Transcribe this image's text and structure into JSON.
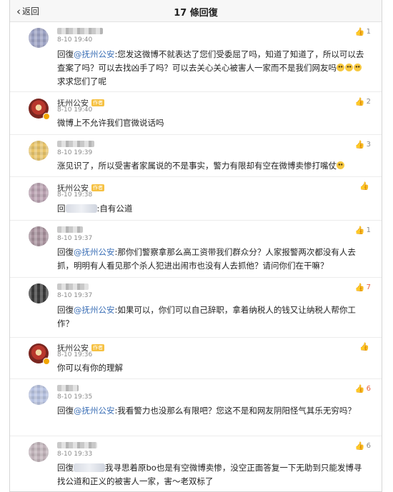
{
  "header": {
    "back_label": "返回",
    "title": "17 條回復"
  },
  "comments": [
    {
      "name": "",
      "time": "8-10 19:40",
      "likes": "1",
      "reply": "回復",
      "mention": "@抚州公安",
      "text": ":您发这微博不就表达了您们受委屈了吗，知道了知道了，所以可以去查案了吗？可以去找凶手了吗？可以去关心关心被害人一家而不是我们网友吗",
      "text_tail": "求求您们了呢"
    },
    {
      "name": "抚州公安",
      "tag": "作者",
      "time": "8-10 19:40",
      "likes": "2",
      "text": "微博上不允许我们官微说话吗"
    },
    {
      "name": "",
      "time": "8-10 19:39",
      "likes": "3",
      "text": "涨见识了，所以受害者家属说的不是事实，警力有限却有空在微博卖惨打嘴仗"
    },
    {
      "name": "抚州公安",
      "tag": "作者",
      "time": "8-10 19:38",
      "likes": "",
      "reply": "回",
      "text": ":自有公道"
    },
    {
      "name": "",
      "time": "8-10 19:37",
      "likes": "1",
      "reply": "回復",
      "mention": "@抚州公安",
      "text": ":那你们警察拿那么高工资带我们群众分？人家报警两次都没有人去抓，明明有人看见那个杀人犯进出闹市也没有人去抓他？请问你们在干嘛？"
    },
    {
      "name": "",
      "time": "8-10 19:37",
      "likes": "7",
      "reply": "回復",
      "mention": "@抚州公安",
      "text": ":如果可以，你们可以自己辞职，拿着纳税人的钱又让纳税人帮你工作？"
    },
    {
      "name": "抚州公安",
      "tag": "作者",
      "time": "8-10 19:36",
      "likes": "",
      "text": "你可以有你的理解"
    },
    {
      "name": "",
      "time": "8-10 19:35",
      "likes": "6",
      "reply": "回復",
      "mention": "@抚州公安",
      "text": ":我看警力也没那么有限吧？您这不是和网友阴阳怪气其乐无穷吗？"
    },
    {
      "name": "",
      "time": "8-10 19:33",
      "likes": "6",
      "reply": "回復",
      "text": "我寻思着原bo也是有空微博卖惨，没空正面答复一下无助到只能发博寻找公道和正义的被害人一家，害～老双标了"
    }
  ]
}
